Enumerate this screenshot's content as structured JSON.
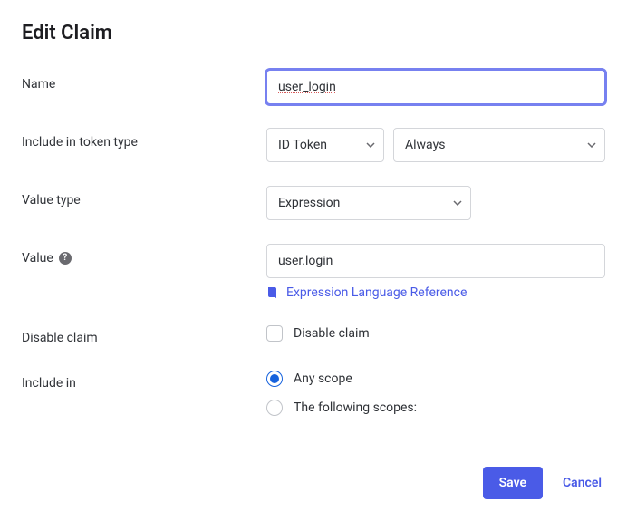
{
  "title": "Edit Claim",
  "fields": {
    "name": {
      "label": "Name",
      "value": "user_login"
    },
    "include_token_type": {
      "label": "Include in token type",
      "select1": "ID Token",
      "select2": "Always"
    },
    "value_type": {
      "label": "Value type",
      "select": "Expression"
    },
    "value": {
      "label": "Value",
      "value": "user.login",
      "link_text": "Expression Language Reference"
    },
    "disable_claim": {
      "label": "Disable claim",
      "option": "Disable claim",
      "checked": false
    },
    "include_in": {
      "label": "Include in",
      "option_any": "Any scope",
      "option_following": "The following scopes:",
      "selected": "any"
    }
  },
  "footer": {
    "save": "Save",
    "cancel": "Cancel"
  }
}
